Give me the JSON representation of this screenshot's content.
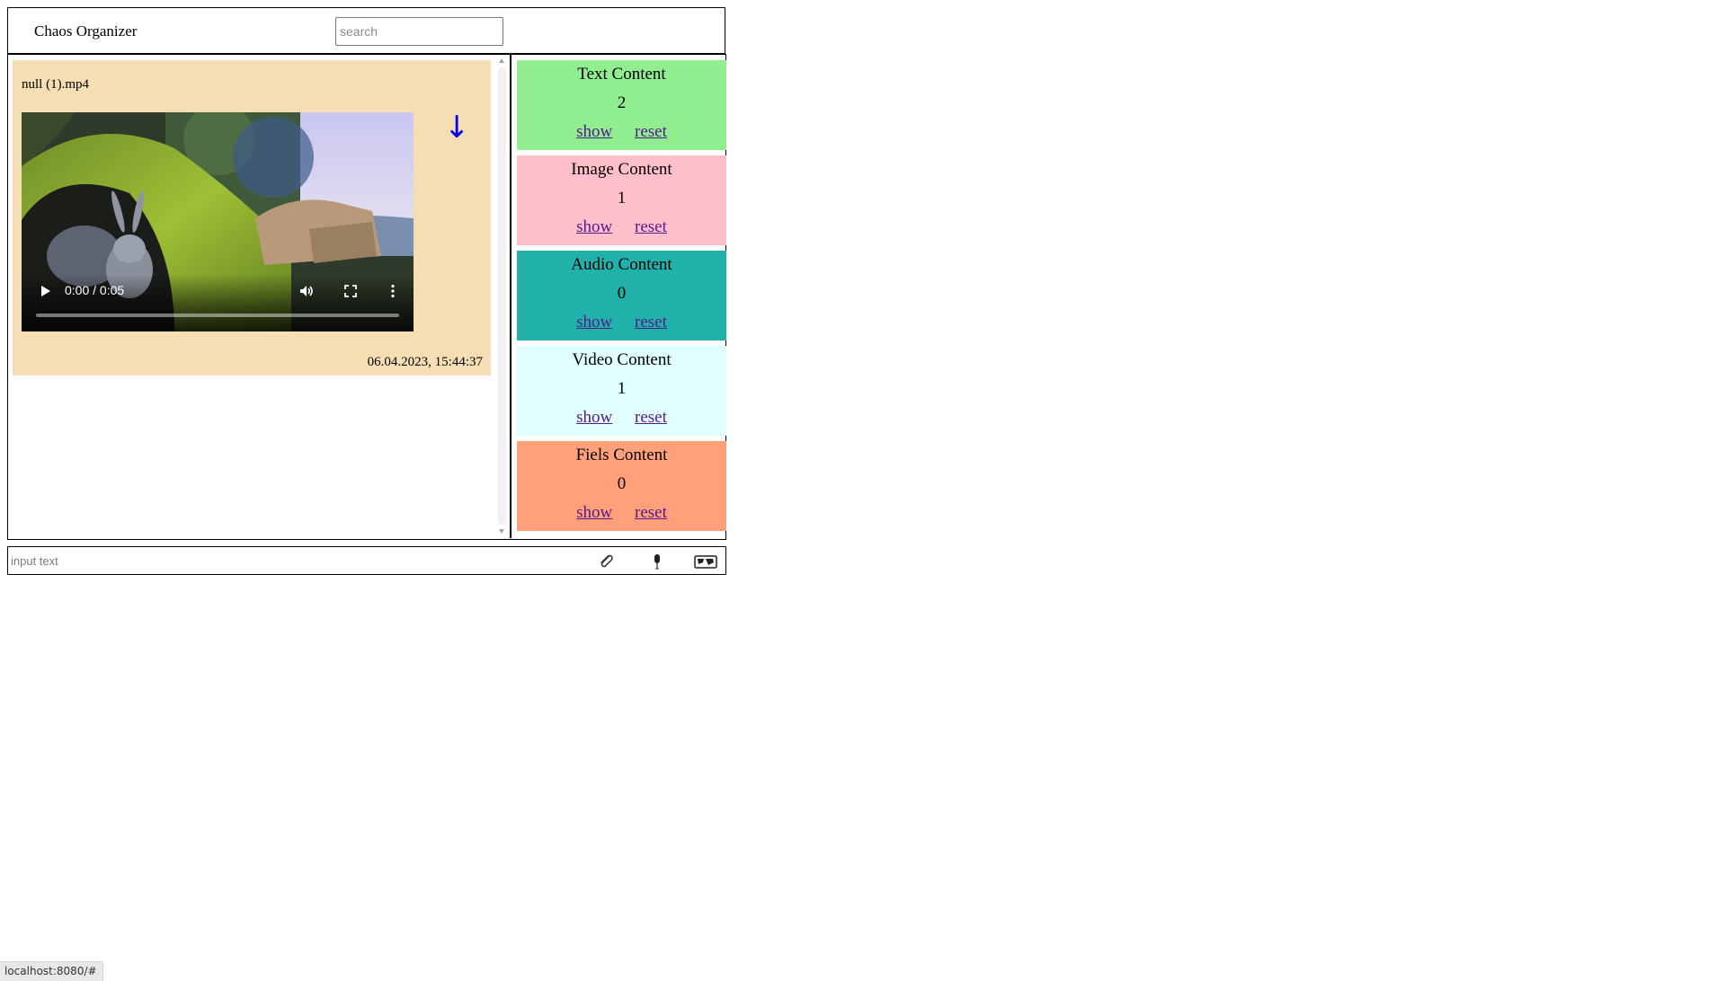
{
  "header": {
    "title": "Chaos Organizer",
    "search_placeholder": "search"
  },
  "messages": [
    {
      "filename": "null (1).mp4",
      "timestamp": "06.04.2023, 15:44:37",
      "video": {
        "time": "0:00 / 0:05",
        "progress_fraction": 0
      },
      "download_glyph": "↓"
    }
  ],
  "stats": [
    {
      "title": "Text Content",
      "count": "2",
      "show": "show",
      "reset": "reset",
      "color": "#90ee90"
    },
    {
      "title": "Image Content",
      "count": "1",
      "show": "show",
      "reset": "reset",
      "color": "#ffc0cb"
    },
    {
      "title": "Audio Content",
      "count": "0",
      "show": "show",
      "reset": "reset",
      "color": "#20b2aa"
    },
    {
      "title": "Video Content",
      "count": "1",
      "show": "show",
      "reset": "reset",
      "color": "#e0ffff"
    },
    {
      "title": "Fiels Content",
      "count": "0",
      "show": "show",
      "reset": "reset",
      "color": "#ffa07a"
    }
  ],
  "input_bar": {
    "placeholder": "input text",
    "icons": [
      "paperclip-icon",
      "microphone-icon",
      "video-camera-icon"
    ]
  },
  "status_bar": {
    "url": "localhost:8080/#"
  },
  "colors": {
    "message_card": "#f5deb3",
    "link": "#551a8b",
    "download_arrow": "#0000ee"
  }
}
